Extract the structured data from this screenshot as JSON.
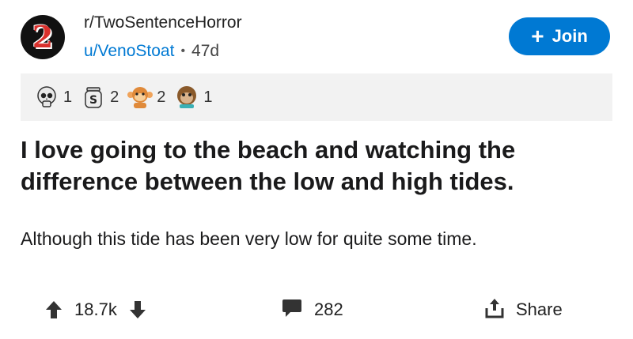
{
  "post": {
    "subreddit": "r/TwoSentenceHorror",
    "subreddit_icon_text": "2",
    "username": "u/VenoStoat",
    "separator": "•",
    "age": "47d",
    "join_label": "Join",
    "title": "I love going to the beach and watching the difference between the low and high tides.",
    "body": "Although this tide has been very low for quite some time."
  },
  "awards": [
    {
      "icon": "skull-award-icon",
      "count": "1"
    },
    {
      "icon": "jar-award-icon",
      "count": "2"
    },
    {
      "icon": "monkey-award-icon",
      "count": "2"
    },
    {
      "icon": "ape-award-icon",
      "count": "1"
    }
  ],
  "footer": {
    "score": "18.7k",
    "comments": "282",
    "share_label": "Share"
  },
  "colors": {
    "accent": "#0079d3",
    "award_bar": "#f2f2f2"
  }
}
